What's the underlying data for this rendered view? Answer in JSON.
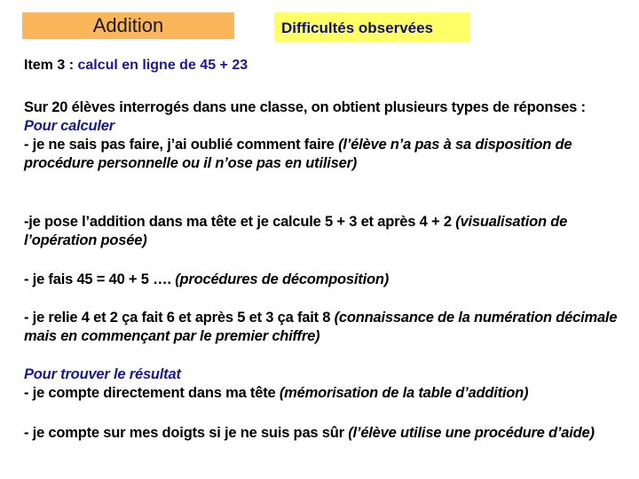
{
  "header": {
    "title": "Addition",
    "subtitle": "Difficultés observées"
  },
  "item": {
    "label": "Item 3 : ",
    "description": "calcul en ligne de 45 + 23"
  },
  "intro": "Sur 20 élèves interrogés dans une classe, on obtient plusieurs types de réponses :",
  "section_calculer": {
    "heading": "Pour calculer",
    "responses": [
      {
        "text": "- je ne sais pas faire, j’ai oublié comment faire ",
        "note": "(l’élève n’a pas à sa disposition de procédure personnelle ou il n’ose pas en utiliser)"
      },
      {
        "text": "-je pose l’addition dans ma tête et je calcule 5 + 3 et après 4 + 2 ",
        "note": "(visualisation de l’opération posée)"
      },
      {
        "text": "- je fais 45 = 40 + 5 …. ",
        "note": "(procédures de décomposition)"
      },
      {
        "text": "- je relie 4 et 2 ça fait 6 et après 5 et 3 ça fait 8 ",
        "note": "(connaissance de la numération décimale mais en commençant par le premier chiffre)"
      }
    ]
  },
  "section_resultat": {
    "heading": "Pour trouver le résultat",
    "responses": [
      {
        "text": "- je compte directement dans ma tête ",
        "note": "(mémorisation de la table d’addition)"
      },
      {
        "text": "- je compte sur mes doigts si je ne suis pas sûr ",
        "note": "(l’élève utilise une procédure d’aide)"
      }
    ]
  },
  "colors": {
    "title_box": "#fbb55a",
    "subtitle_box": "#ffff66",
    "accent_blue": "#1a1a8c"
  }
}
